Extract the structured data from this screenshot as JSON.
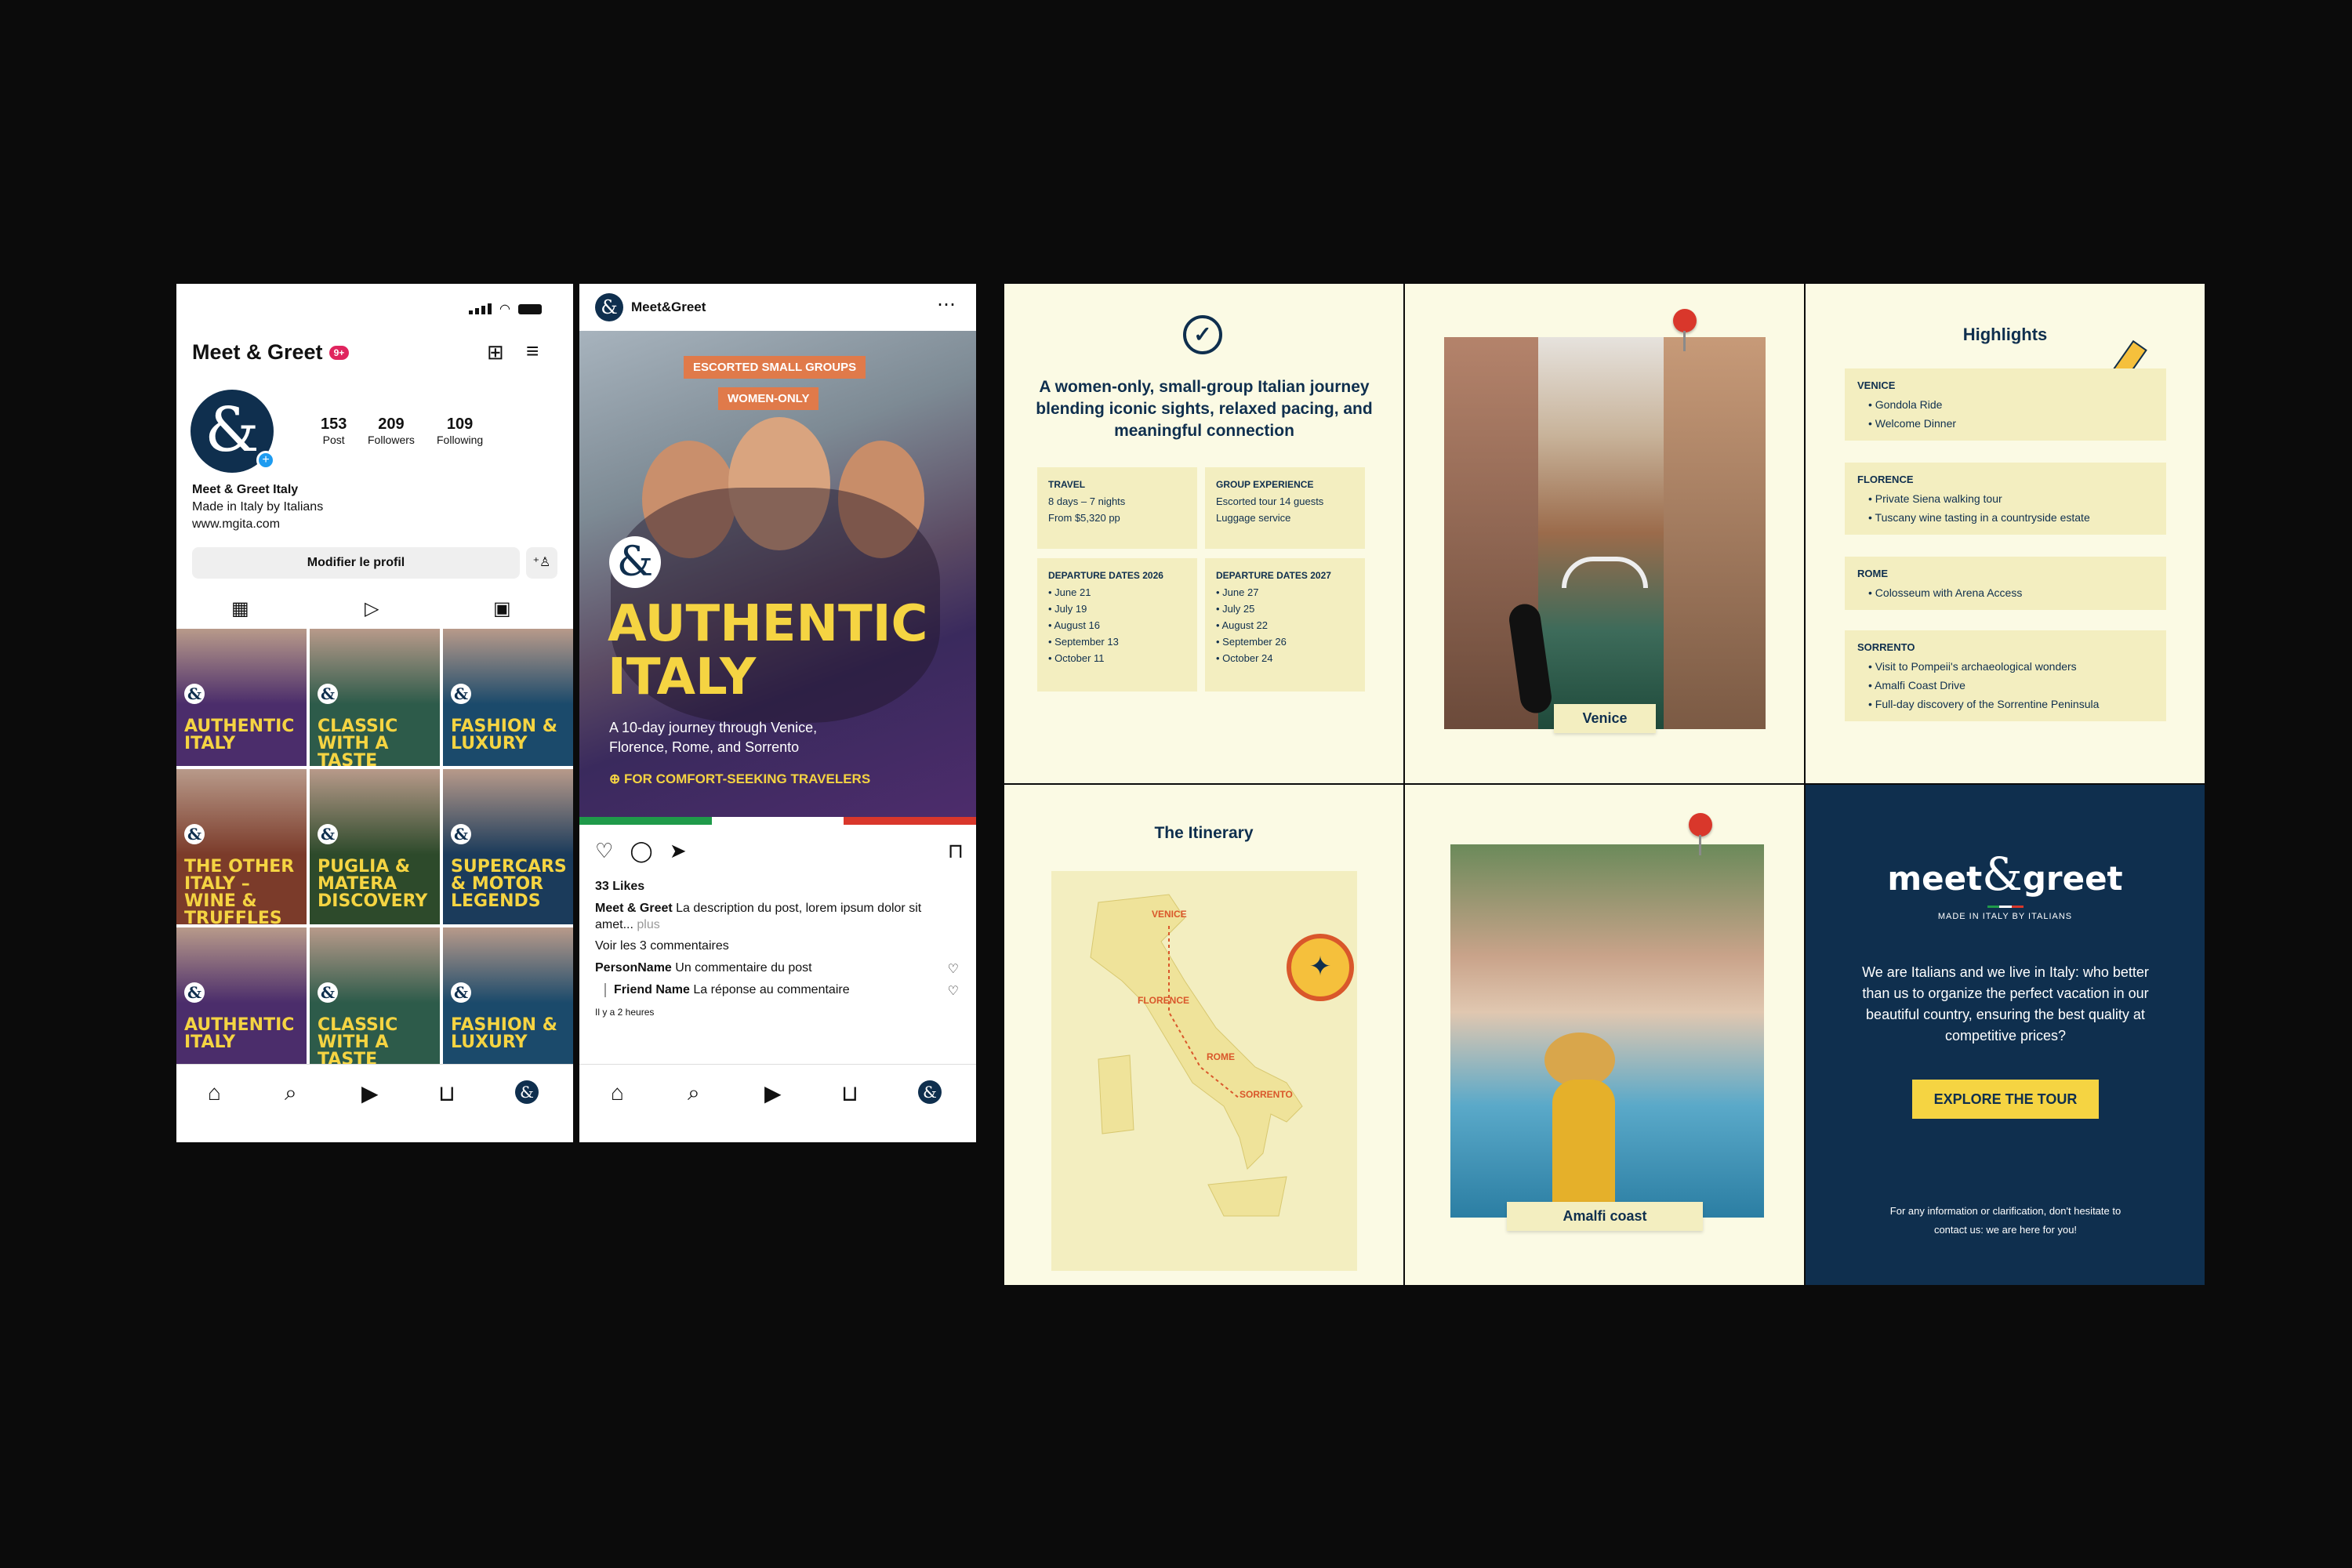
{
  "profile": {
    "title": "Meet & Greet",
    "badge": "9+",
    "stats": [
      {
        "value": "153",
        "label": "Post"
      },
      {
        "value": "209",
        "label": "Followers"
      },
      {
        "value": "109",
        "label": "Following"
      }
    ],
    "bio_name": "Meet & Greet Italy",
    "bio_line": "Made in Italy by Italians",
    "bio_url": "www.mgita.com",
    "edit_label": "Modifier le profil",
    "tiles": [
      {
        "title": "AUTHENTIC ITALY",
        "bg": "#4b2d6b"
      },
      {
        "title": "CLASSIC WITH A TASTE",
        "bg": "#2d5b4a"
      },
      {
        "title": "FASHION & LUXURY",
        "bg": "#1b4a6b"
      },
      {
        "title": "THE OTHER ITALY – WINE & TRUFFLES",
        "bg": "#7b3b2a"
      },
      {
        "title": "PUGLIA & MATERA DISCOVERY",
        "bg": "#2d4a2b"
      },
      {
        "title": "SUPERCARS & MOTOR LEGENDS",
        "bg": "#1b3b5b"
      },
      {
        "title": "AUTHENTIC ITALY",
        "bg": "#4b2d6b"
      },
      {
        "title": "CLASSIC WITH A TASTE",
        "bg": "#2d5b4a"
      },
      {
        "title": "FASHION & LUXURY",
        "bg": "#1b4a6b"
      }
    ]
  },
  "post": {
    "account": "Meet&Greet",
    "tag1": "ESCORTED SMALL GROUPS",
    "tag2": "WOMEN-ONLY",
    "headline1": "AUTHENTIC",
    "headline2": "ITALY",
    "subtitle": "A 10-day journey through Venice, Florence, Rome, and Sorrento",
    "cta": "FOR COMFORT-SEEKING TRAVELERS",
    "likes": "33 Likes",
    "desc_user": "Meet & Greet",
    "desc_text": "La description du post, lorem ipsum dolor sit amet...",
    "desc_more": "plus",
    "view_comments": "Voir les 3 commentaires",
    "c1_user": "PersonName",
    "c1_text": "Un commentaire du post",
    "c2_user": "Friend Name",
    "c2_text": "La réponse au commentaire",
    "time": "Il y a 2 heures"
  },
  "slide1": {
    "heading": "A women-only, small-group Italian journey blending iconic sights, relaxed pacing, and meaningful connection",
    "travel_title": "TRAVEL",
    "travel_lines": [
      "8 days – 7 nights",
      "From $5,320 pp"
    ],
    "group_title": "GROUP EXPERIENCE",
    "group_lines": [
      "Escorted tour 14 guests",
      "Luggage service"
    ],
    "dep26_title": "DEPARTURE DATES 2026",
    "dep26": [
      "June 21",
      "July 19",
      "August 16",
      "September 13",
      "October 11"
    ],
    "dep27_title": "DEPARTURE DATES 2027",
    "dep27": [
      "June 27",
      "July 25",
      "August 22",
      "September 26",
      "October 24"
    ]
  },
  "slide2": {
    "label": "Venice"
  },
  "slide3": {
    "title": "Highlights",
    "venice_title": "VENICE",
    "venice": [
      "Gondola Ride",
      "Welcome Dinner"
    ],
    "florence_title": "FLORENCE",
    "florence": [
      "Private Siena walking tour",
      "Tuscany wine tasting in a countryside estate"
    ],
    "rome_title": "ROME",
    "rome": [
      "Colosseum with Arena Access"
    ],
    "sorrento_title": "SORRENTO",
    "sorrento": [
      "Visit to Pompeii's archaeological wonders",
      "Amalfi Coast Drive",
      "Full-day discovery of the Sorrentine Peninsula"
    ]
  },
  "slide4": {
    "title": "The Itinerary",
    "cities": [
      "VENICE",
      "FLORENCE",
      "ROME",
      "SORRENTO"
    ]
  },
  "slide5": {
    "label": "Amalfi coast"
  },
  "slide6": {
    "logo_left": "meet",
    "logo_amp": "&",
    "logo_right": "greet",
    "tagline": "MADE IN ITALY BY ITALIANS",
    "body": "We are Italians and we live in Italy: who better than us to organize the perfect vacation in our beautiful country, ensuring the best quality at competitive prices?",
    "button": "EXPLORE THE TOUR",
    "footer": "For any information or clarification, don't hesitate to contact us: we are here for you!"
  },
  "colors": {
    "navy": "#0f2f4e",
    "yellow": "#f5d442",
    "orange": "#e07a4a",
    "cream": "#fbfae4",
    "green": "#1f9a4a",
    "red": "#d9372b"
  }
}
